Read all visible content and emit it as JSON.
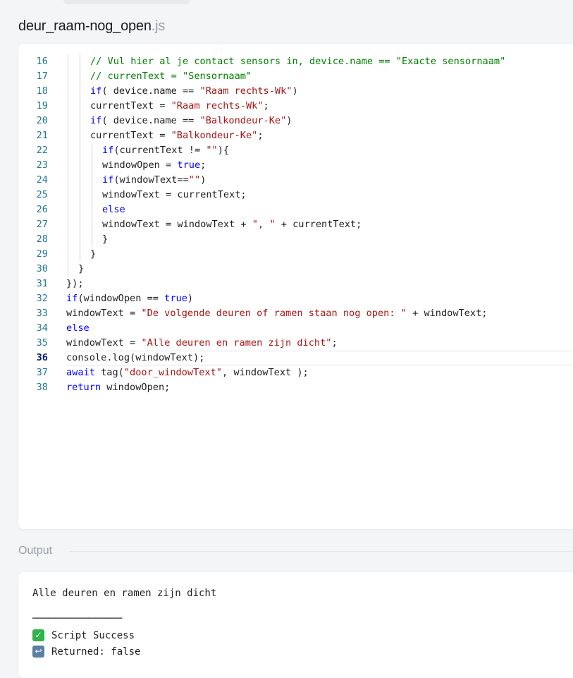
{
  "file": {
    "name": "deur_raam-nog_open",
    "extension": ".js"
  },
  "editor": {
    "active_line": 36,
    "lines": [
      {
        "num": "16",
        "segs": [
          {
            "c": "cm",
            "t": "// Vul hier al je contact sensors in, device.name == \"Exacte sensornaam\""
          }
        ]
      },
      {
        "num": "17",
        "segs": [
          {
            "c": "cm",
            "t": "// currenText = \"Sensornaam\""
          }
        ]
      },
      {
        "num": "18",
        "segs": [
          {
            "c": "kw",
            "t": "if"
          },
          {
            "c": "",
            "t": "( device.name == "
          },
          {
            "c": "st",
            "t": "\"Raam rechts-Wk\""
          },
          {
            "c": "",
            "t": ")"
          }
        ]
      },
      {
        "num": "19",
        "segs": [
          {
            "c": "",
            "t": "currentText = "
          },
          {
            "c": "st",
            "t": "\"Raam rechts-Wk\""
          },
          {
            "c": "",
            "t": ";"
          }
        ]
      },
      {
        "num": "20",
        "segs": [
          {
            "c": "kw",
            "t": "if"
          },
          {
            "c": "",
            "t": "( device.name == "
          },
          {
            "c": "st",
            "t": "\"Balkondeur-Ke\""
          },
          {
            "c": "",
            "t": ")"
          }
        ]
      },
      {
        "num": "21",
        "segs": [
          {
            "c": "",
            "t": "currentText = "
          },
          {
            "c": "st",
            "t": "\"Balkondeur-Ke\""
          },
          {
            "c": "",
            "t": ";"
          }
        ]
      },
      {
        "num": "22",
        "segs": [
          {
            "c": "kw",
            "t": "if"
          },
          {
            "c": "",
            "t": "(currentText != "
          },
          {
            "c": "st",
            "t": "\"\""
          },
          {
            "c": "",
            "t": "){"
          }
        ]
      },
      {
        "num": "23",
        "segs": [
          {
            "c": "",
            "t": "windowOpen = "
          },
          {
            "c": "kw",
            "t": "true"
          },
          {
            "c": "",
            "t": ";"
          }
        ]
      },
      {
        "num": "24",
        "segs": [
          {
            "c": "kw",
            "t": "if"
          },
          {
            "c": "",
            "t": "(windowText=="
          },
          {
            "c": "st",
            "t": "\"\""
          },
          {
            "c": "",
            "t": ")"
          }
        ]
      },
      {
        "num": "25",
        "segs": [
          {
            "c": "",
            "t": "windowText = currentText;"
          }
        ]
      },
      {
        "num": "26",
        "segs": [
          {
            "c": "kw",
            "t": "else"
          }
        ]
      },
      {
        "num": "27",
        "segs": [
          {
            "c": "",
            "t": "windowText = windowText + "
          },
          {
            "c": "st",
            "t": "\", \""
          },
          {
            "c": "",
            "t": " + currentText;"
          }
        ]
      },
      {
        "num": "28",
        "segs": [
          {
            "c": "",
            "t": "}"
          }
        ]
      },
      {
        "num": "29",
        "segs": [
          {
            "c": "",
            "t": "}"
          }
        ]
      },
      {
        "num": "30",
        "segs": [
          {
            "c": "",
            "t": "}"
          }
        ]
      },
      {
        "num": "31",
        "segs": [
          {
            "c": "",
            "t": "});"
          }
        ]
      },
      {
        "num": "32",
        "segs": [
          {
            "c": "kw",
            "t": "if"
          },
          {
            "c": "",
            "t": "(windowOpen == "
          },
          {
            "c": "kw",
            "t": "true"
          },
          {
            "c": "",
            "t": ")"
          }
        ]
      },
      {
        "num": "33",
        "segs": [
          {
            "c": "",
            "t": "windowText = "
          },
          {
            "c": "st",
            "t": "\"De volgende deuren of ramen staan nog open: \""
          },
          {
            "c": "",
            "t": " + windowText;"
          }
        ]
      },
      {
        "num": "34",
        "segs": [
          {
            "c": "kw",
            "t": "else"
          }
        ]
      },
      {
        "num": "35",
        "segs": [
          {
            "c": "",
            "t": "windowText = "
          },
          {
            "c": "st",
            "t": "\"Alle deuren en ramen zijn dicht\""
          },
          {
            "c": "",
            "t": ";"
          }
        ]
      },
      {
        "num": "36",
        "segs": [
          {
            "c": "",
            "t": "console.log(windowText);"
          }
        ]
      },
      {
        "num": "37",
        "segs": [
          {
            "c": "kw",
            "t": "await"
          },
          {
            "c": "",
            "t": " tag("
          },
          {
            "c": "st",
            "t": "\"door_windowText\""
          },
          {
            "c": "",
            "t": ", windowText );"
          }
        ]
      },
      {
        "num": "38",
        "segs": [
          {
            "c": "kw",
            "t": "return"
          },
          {
            "c": "",
            "t": " windowOpen;"
          }
        ]
      }
    ]
  },
  "output": {
    "label": "Output",
    "text": "Alle deuren en ramen zijn dicht",
    "separator": "────────────────",
    "success_icon": "check-mark-icon",
    "success_text": "Script Success",
    "return_icon": "return-arrow-icon",
    "return_text": "Returned: false"
  },
  "colors": {
    "comment": "#008000",
    "keyword": "#0000ff",
    "string": "#a31515",
    "line_number": "#237893"
  }
}
